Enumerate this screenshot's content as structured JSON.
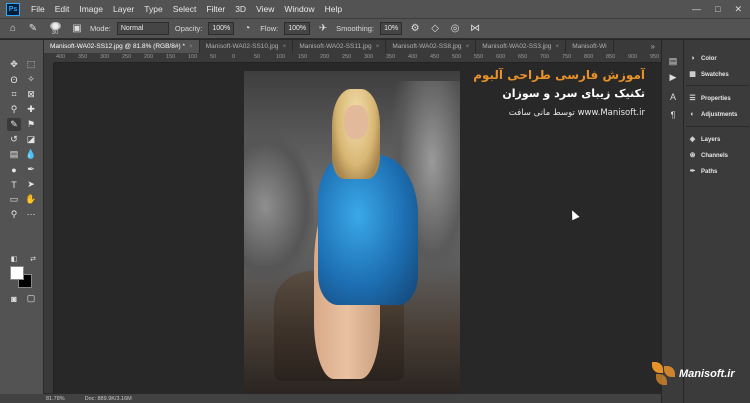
{
  "app": {
    "logo": "Ps"
  },
  "menu": [
    "File",
    "Edit",
    "Image",
    "Layer",
    "Type",
    "Select",
    "Filter",
    "3D",
    "View",
    "Window",
    "Help"
  ],
  "window_controls": [
    "—",
    "□",
    "✕"
  ],
  "options": {
    "brush_size": "30",
    "mode_label": "Mode:",
    "mode_value": "Normal",
    "opacity_label": "Opacity:",
    "opacity_value": "100%",
    "flow_label": "Flow:",
    "flow_value": "100%",
    "smoothing_label": "Smoothing:",
    "smoothing_value": "10%"
  },
  "tabs": [
    {
      "label": "Manisoft-WA02-SS12.jpg @ 81.8% (RGB/8#) *",
      "active": true
    },
    {
      "label": "Manisoft-WA02-SS10.jpg",
      "active": false
    },
    {
      "label": "Manisoft-WA02-SS11.jpg",
      "active": false
    },
    {
      "label": "Manisoft-WA02-SS8.jpg",
      "active": false
    },
    {
      "label": "Manisoft-WA02-SS3.jpg",
      "active": false
    },
    {
      "label": "Manisoft-Wi",
      "active": false
    }
  ],
  "ruler_ticks": [
    "400",
    "350",
    "300",
    "250",
    "200",
    "150",
    "100",
    "50",
    "0",
    "50",
    "100",
    "150",
    "200",
    "250",
    "300",
    "350",
    "400",
    "450",
    "500",
    "550",
    "600",
    "650",
    "700",
    "750",
    "800",
    "850",
    "900",
    "950"
  ],
  "overlay": {
    "line1": "آموزش فارسی طراحی آلبوم",
    "line2": "تکنیک زیبای سرد و سوزان",
    "line3": "www.Manisoft.ir  توسط مانی سافت"
  },
  "status": {
    "zoom": "81.78%",
    "doc": "Doc: 889.9K/3.16M"
  },
  "panels": {
    "color": "Color",
    "swatches": "Swatches",
    "properties": "Properties",
    "adjustments": "Adjustments",
    "layers": "Layers",
    "channels": "Channels",
    "paths": "Paths"
  },
  "brand": {
    "text": "Manisoft.ir",
    "color": "#e8922a"
  },
  "colors": {
    "foreground": "#ffffff",
    "background": "#000000",
    "accent": "#31a8ff"
  }
}
